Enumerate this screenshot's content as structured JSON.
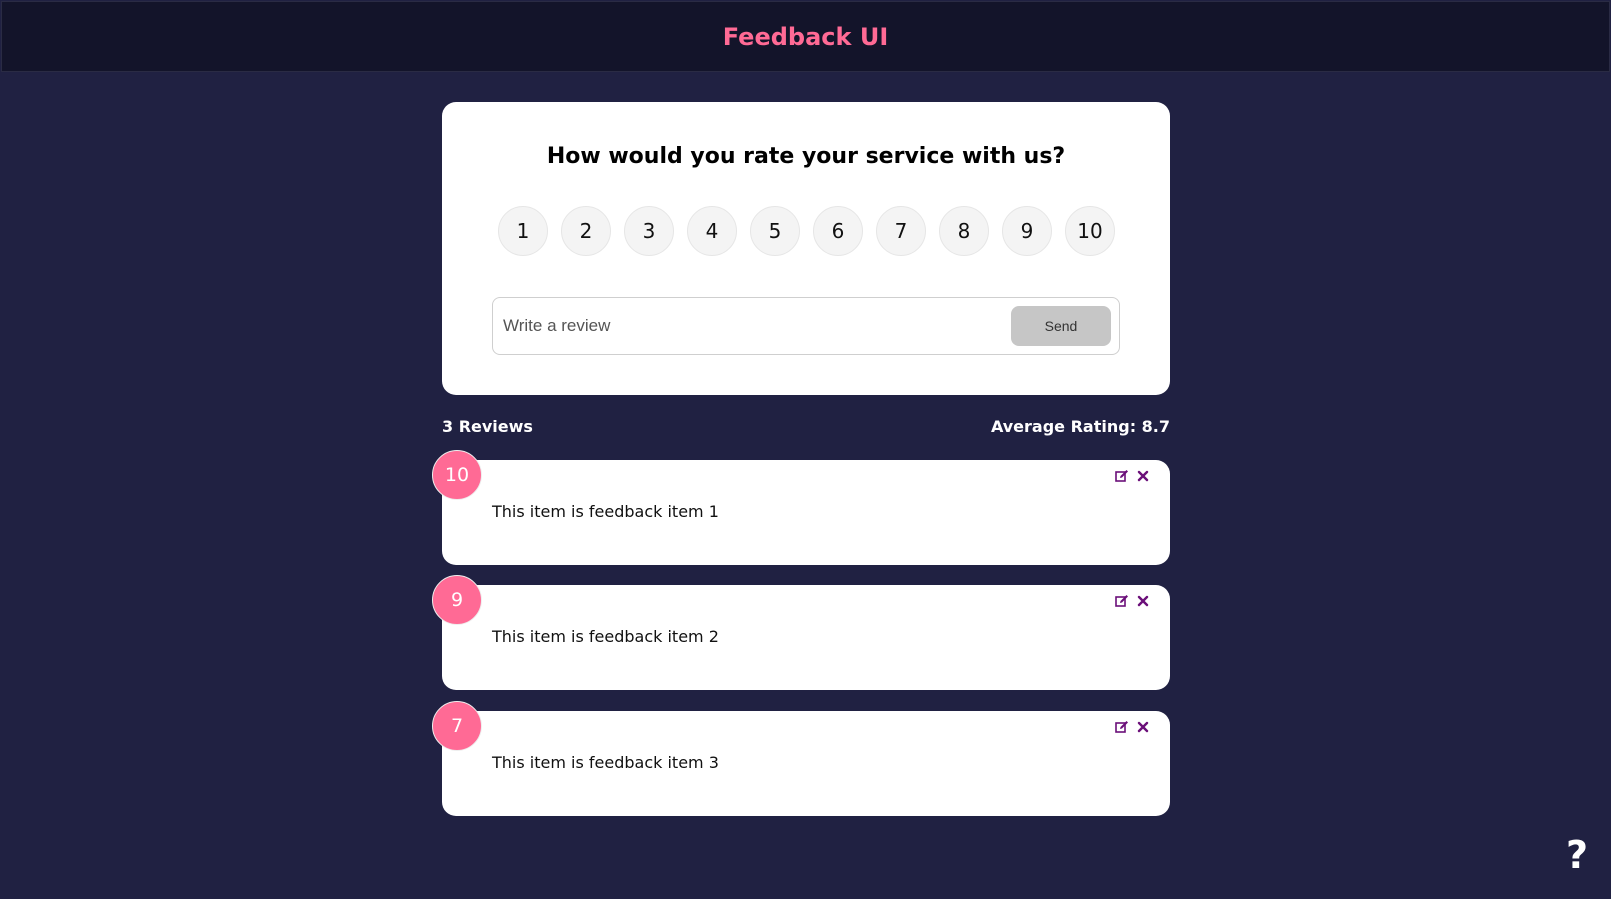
{
  "header": {
    "title": "Feedback UI"
  },
  "rating_card": {
    "question": "How would you rate your service with us?",
    "options": [
      "1",
      "2",
      "3",
      "4",
      "5",
      "6",
      "7",
      "8",
      "9",
      "10"
    ],
    "input_placeholder": "Write a review",
    "send_label": "Send"
  },
  "stats": {
    "reviews_label": "3 Reviews",
    "average_label": "Average Rating: 8.7"
  },
  "feedback_items": [
    {
      "rating": "10",
      "text": "This item is feedback item 1"
    },
    {
      "rating": "9",
      "text": "This item is feedback item 2"
    },
    {
      "rating": "7",
      "text": "This item is feedback item 3"
    }
  ],
  "icons": {
    "edit": "edit-icon",
    "delete": "close-icon",
    "help": "question-icon"
  },
  "help_label": "?",
  "colors": {
    "accent": "#ff6a95",
    "background": "#202142",
    "header": "#13142a",
    "icon": "#6b0f79"
  }
}
